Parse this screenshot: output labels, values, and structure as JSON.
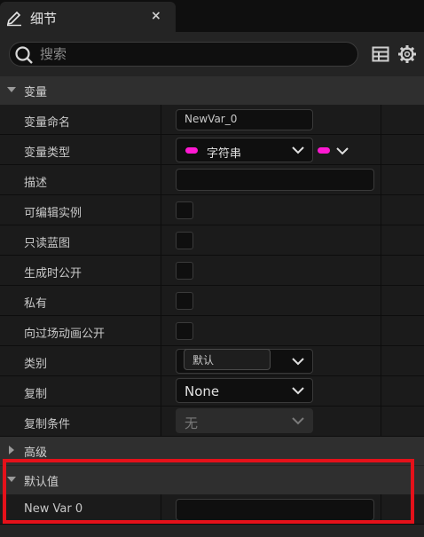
{
  "tab": {
    "title": "细节",
    "close": "×"
  },
  "search": {
    "placeholder": "搜索"
  },
  "sections": {
    "variable": "变量",
    "advanced": "高级",
    "default_value": "默认值"
  },
  "rows": {
    "var_name": {
      "label": "变量命名",
      "value": "NewVar_0"
    },
    "var_type": {
      "label": "变量类型",
      "value": "字符串"
    },
    "description": {
      "label": "描述",
      "value": ""
    },
    "instance_editable": {
      "label": "可编辑实例"
    },
    "blueprint_readonly": {
      "label": "只读蓝图"
    },
    "expose_on_spawn": {
      "label": "生成时公开"
    },
    "private": {
      "label": "私有"
    },
    "expose_cinematics": {
      "label": "向过场动画公开"
    },
    "category": {
      "label": "类别",
      "value": "默认"
    },
    "replication": {
      "label": "复制",
      "value": "None"
    },
    "replication_condition": {
      "label": "复制条件",
      "value": "无"
    },
    "default_var": {
      "label": "New Var 0",
      "value": ""
    }
  },
  "colors": {
    "string_pin": "#ff19d2",
    "highlight": "#e5111a"
  }
}
